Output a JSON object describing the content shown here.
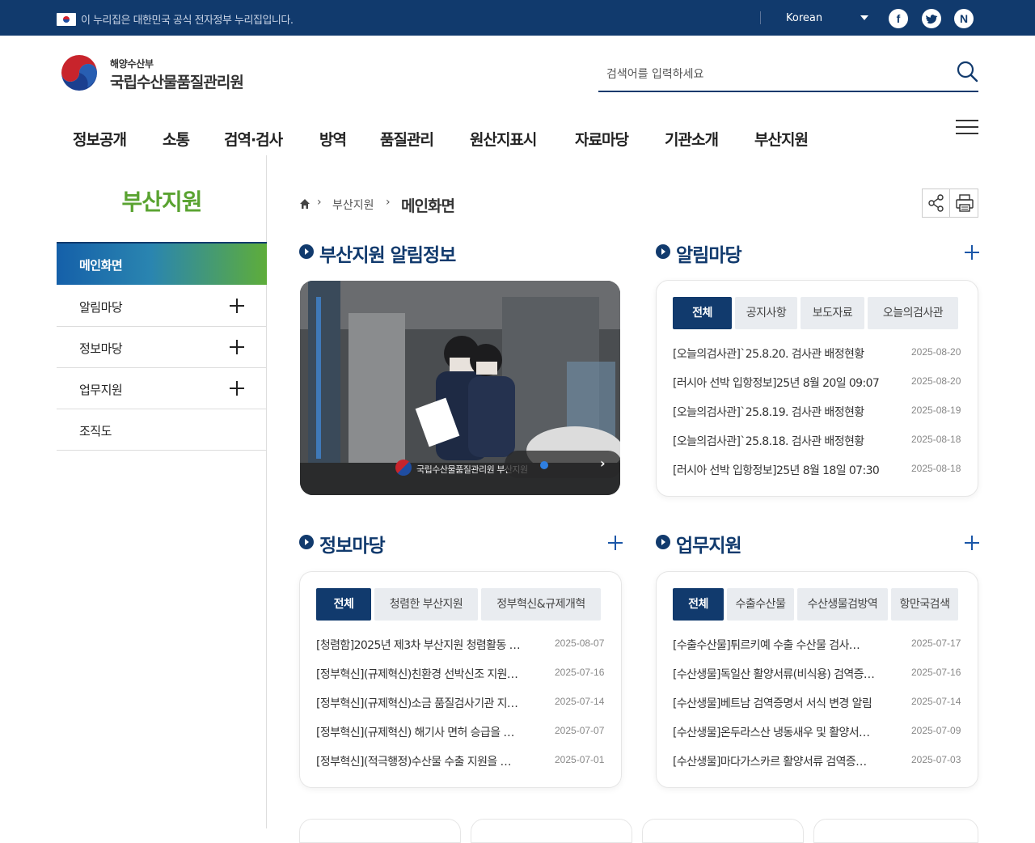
{
  "topbar": {
    "gov_notice": "이 누리집은 대한민국 공식 전자정부 누리집입니다.",
    "language": "Korean",
    "sns": [
      "facebook-icon",
      "twitter-icon",
      "naver-blog-icon"
    ]
  },
  "header": {
    "ministry": "해양수산부",
    "org_name": "국립수산물품질관리원",
    "search_placeholder": "검색어를 입력하세요"
  },
  "gnb": [
    "정보공개",
    "소통",
    "검역·검사",
    "방역",
    "품질관리",
    "원산지표시",
    "자료마당",
    "기관소개",
    "부산지원"
  ],
  "sidebar": {
    "title": "부산지원",
    "items": [
      {
        "label": "메인화면",
        "active": true,
        "expandable": false
      },
      {
        "label": "알림마당",
        "active": false,
        "expandable": true
      },
      {
        "label": "정보마당",
        "active": false,
        "expandable": true
      },
      {
        "label": "업무지원",
        "active": false,
        "expandable": true
      },
      {
        "label": "조직도",
        "active": false,
        "expandable": false
      }
    ]
  },
  "breadcrumb": {
    "level1": "부산지원",
    "current": "메인화면"
  },
  "sections": {
    "branch_news": {
      "title": "부산지원 알림정보",
      "caption": "국립수산물품질관리원 부산지원"
    },
    "notice": {
      "title": "알림마당",
      "tabs": [
        "전체",
        "공지사항",
        "보도자료",
        "오늘의검사관"
      ],
      "items": [
        {
          "title": "[오늘의검사관]`25.8.20. 검사관 배정현황",
          "date": "2025-08-20"
        },
        {
          "title": "[러시아 선박 입항정보]25년 8월 20일 09:07",
          "date": "2025-08-20"
        },
        {
          "title": "[오늘의검사관]`25.8.19. 검사관 배정현황",
          "date": "2025-08-19"
        },
        {
          "title": "[오늘의검사관]`25.8.18. 검사관 배정현황",
          "date": "2025-08-18"
        },
        {
          "title": "[러시아 선박 입항정보]25년 8월 18일 07:30",
          "date": "2025-08-18"
        }
      ]
    },
    "info": {
      "title": "정보마당",
      "tabs": [
        "전체",
        "청렴한 부산지원",
        "정부혁신&규제개혁"
      ],
      "items": [
        {
          "title": "[청렴함]2025년 제3차 부산지원 청렴활동 …",
          "date": "2025-08-07"
        },
        {
          "title": "[정부혁신](규제혁신)친환경 선박신조 지원…",
          "date": "2025-07-16"
        },
        {
          "title": "[정부혁신](규제혁신)소금 품질검사기관 지…",
          "date": "2025-07-14"
        },
        {
          "title": "[정부혁신](규제혁신) 해기사 면허 승급을 …",
          "date": "2025-07-07"
        },
        {
          "title": "[정부혁신](적극행정)수산물 수출 지원을 …",
          "date": "2025-07-01"
        }
      ]
    },
    "work": {
      "title": "업무지원",
      "tabs": [
        "전체",
        "수출수산물",
        "수산생물검방역",
        "항만국검색"
      ],
      "items": [
        {
          "title": "[수출수산물]튀르키예 수출 수산물 검사…",
          "date": "2025-07-17"
        },
        {
          "title": "[수산생물]독일산 활양서류(비식용) 검역증…",
          "date": "2025-07-16"
        },
        {
          "title": "[수산생물]베트남 검역증명서 서식 변경 알림",
          "date": "2025-07-14"
        },
        {
          "title": "[수산생물]온두라스산 냉동새우 및 활양서…",
          "date": "2025-07-09"
        },
        {
          "title": "[수산생물]마다가스카르 활양서류 검역증…",
          "date": "2025-07-03"
        }
      ]
    }
  },
  "colors": {
    "navy": "#113a6d",
    "green": "#5aa331",
    "gradient_start": "#1560a9",
    "gradient_end": "#5ead3a"
  }
}
